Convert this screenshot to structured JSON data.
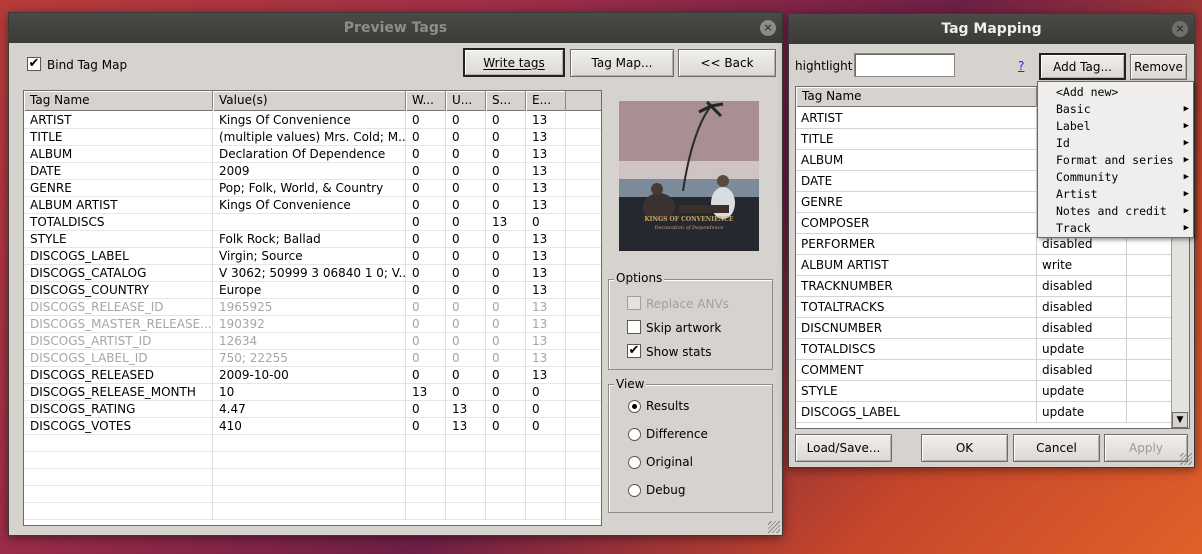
{
  "preview_window": {
    "title": "Preview Tags",
    "close_glyph": "×",
    "bind_tag_map": {
      "label": "Bind Tag Map",
      "checked": true
    },
    "buttons": {
      "write_tags": "Write tags",
      "tag_map": "Tag Map...",
      "back": "<< Back"
    },
    "columns": [
      "Tag Name",
      "Value(s)",
      "W...",
      "U...",
      "S...",
      "E..."
    ],
    "rows": [
      {
        "tag": "ARTIST",
        "value": "Kings Of Convenience",
        "w": "0",
        "u": "0",
        "s": "0",
        "e": "13",
        "disabled": false
      },
      {
        "tag": "TITLE",
        "value": "(multiple values) Mrs. Cold; M...",
        "w": "0",
        "u": "0",
        "s": "0",
        "e": "13",
        "disabled": false
      },
      {
        "tag": "ALBUM",
        "value": "Declaration Of Dependence",
        "w": "0",
        "u": "0",
        "s": "0",
        "e": "13",
        "disabled": false
      },
      {
        "tag": "DATE",
        "value": "2009",
        "w": "0",
        "u": "0",
        "s": "0",
        "e": "13",
        "disabled": false
      },
      {
        "tag": "GENRE",
        "value": "Pop; Folk, World, & Country",
        "w": "0",
        "u": "0",
        "s": "0",
        "e": "13",
        "disabled": false
      },
      {
        "tag": "ALBUM ARTIST",
        "value": "Kings Of Convenience",
        "w": "0",
        "u": "0",
        "s": "0",
        "e": "13",
        "disabled": false
      },
      {
        "tag": "TOTALDISCS",
        "value": "",
        "w": "0",
        "u": "0",
        "s": "13",
        "e": "0",
        "disabled": false
      },
      {
        "tag": "STYLE",
        "value": "Folk Rock; Ballad",
        "w": "0",
        "u": "0",
        "s": "0",
        "e": "13",
        "disabled": false
      },
      {
        "tag": "DISCOGS_LABEL",
        "value": "Virgin; Source",
        "w": "0",
        "u": "0",
        "s": "0",
        "e": "13",
        "disabled": false
      },
      {
        "tag": "DISCOGS_CATALOG",
        "value": "V 3062; 50999 3 06840 1 0; V...",
        "w": "0",
        "u": "0",
        "s": "0",
        "e": "13",
        "disabled": false
      },
      {
        "tag": "DISCOGS_COUNTRY",
        "value": "Europe",
        "w": "0",
        "u": "0",
        "s": "0",
        "e": "13",
        "disabled": false
      },
      {
        "tag": "DISCOGS_RELEASE_ID",
        "value": "1965925",
        "w": "0",
        "u": "0",
        "s": "0",
        "e": "13",
        "disabled": true
      },
      {
        "tag": "DISCOGS_MASTER_RELEASE...",
        "value": "190392",
        "w": "0",
        "u": "0",
        "s": "0",
        "e": "13",
        "disabled": true
      },
      {
        "tag": "DISCOGS_ARTIST_ID",
        "value": "12634",
        "w": "0",
        "u": "0",
        "s": "0",
        "e": "13",
        "disabled": true
      },
      {
        "tag": "DISCOGS_LABEL_ID",
        "value": "750; 22255",
        "w": "0",
        "u": "0",
        "s": "0",
        "e": "13",
        "disabled": true
      },
      {
        "tag": "DISCOGS_RELEASED",
        "value": "2009-10-00",
        "w": "0",
        "u": "0",
        "s": "0",
        "e": "13",
        "disabled": false
      },
      {
        "tag": "DISCOGS_RELEASE_MONTH",
        "value": "10",
        "w": "13",
        "u": "0",
        "s": "0",
        "e": "0",
        "disabled": false
      },
      {
        "tag": "DISCOGS_RATING",
        "value": "4.47",
        "w": "0",
        "u": "13",
        "s": "0",
        "e": "0",
        "disabled": false
      },
      {
        "tag": "DISCOGS_VOTES",
        "value": "410",
        "w": "0",
        "u": "13",
        "s": "0",
        "e": "0",
        "disabled": false
      }
    ],
    "album_art": {
      "line1": "KINGS OF CONVENIENCE",
      "line2": "Declaration of Dependence"
    },
    "options": {
      "title": "Options",
      "replace_anvs": {
        "label": "Replace ANVs",
        "checked": false,
        "disabled": true
      },
      "skip_artwork": {
        "label": "Skip artwork",
        "checked": false
      },
      "show_stats": {
        "label": "Show stats",
        "checked": true
      }
    },
    "view": {
      "title": "View",
      "items": [
        {
          "label": "Results",
          "selected": true
        },
        {
          "label": "Difference",
          "selected": false
        },
        {
          "label": "Original",
          "selected": false
        },
        {
          "label": "Debug",
          "selected": false
        }
      ]
    }
  },
  "mapping_window": {
    "title": "Tag Mapping",
    "close_glyph": "×",
    "highlight_label": "hightlight",
    "highlight_value": "",
    "help_link": "?",
    "buttons": {
      "add_tag": "Add Tag...",
      "remove": "Remove",
      "load_save": "Load/Save...",
      "ok": "OK",
      "cancel": "Cancel",
      "apply": "Apply"
    },
    "columns": [
      "Tag Name",
      ""
    ],
    "rows": [
      {
        "tag": "ARTIST",
        "action": ""
      },
      {
        "tag": "TITLE",
        "action": ""
      },
      {
        "tag": "ALBUM",
        "action": ""
      },
      {
        "tag": "DATE",
        "action": ""
      },
      {
        "tag": "GENRE",
        "action": ""
      },
      {
        "tag": "COMPOSER",
        "action": ""
      },
      {
        "tag": "PERFORMER",
        "action": "disabled"
      },
      {
        "tag": "ALBUM ARTIST",
        "action": "write"
      },
      {
        "tag": "TRACKNUMBER",
        "action": "disabled"
      },
      {
        "tag": "TOTALTRACKS",
        "action": "disabled"
      },
      {
        "tag": "DISCNUMBER",
        "action": "disabled"
      },
      {
        "tag": "TOTALDISCS",
        "action": "update"
      },
      {
        "tag": "COMMENT",
        "action": "disabled"
      },
      {
        "tag": "STYLE",
        "action": "update"
      },
      {
        "tag": "DISCOGS_LABEL",
        "action": "update"
      }
    ],
    "add_menu": [
      {
        "label": "<Add new>",
        "submenu": false
      },
      {
        "label": "Basic",
        "submenu": true
      },
      {
        "label": "Label",
        "submenu": true
      },
      {
        "label": "Id",
        "submenu": true
      },
      {
        "label": "Format and series",
        "submenu": true
      },
      {
        "label": "Community",
        "submenu": true
      },
      {
        "label": "Artist",
        "submenu": true
      },
      {
        "label": "Notes and credit",
        "submenu": true
      },
      {
        "label": "Track",
        "submenu": true
      }
    ],
    "submenu_arrow": "▶",
    "scroll_down_arrow": "▼"
  },
  "check_glyph": "✔"
}
